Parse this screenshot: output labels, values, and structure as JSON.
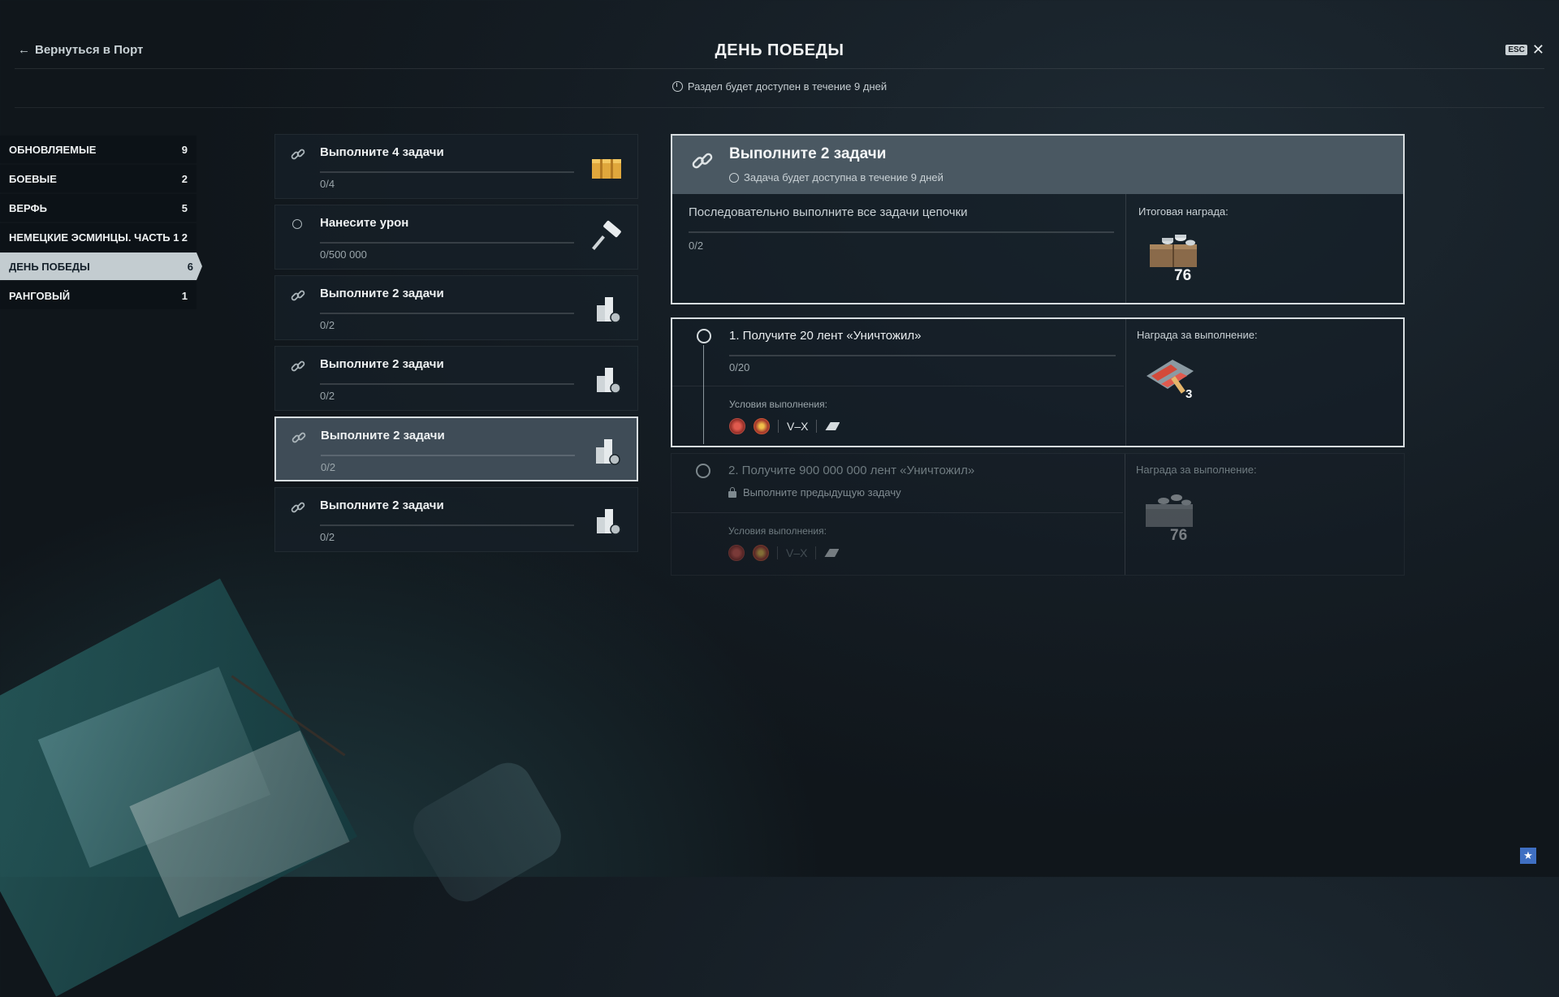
{
  "header": {
    "back_label": "Вернуться в Порт",
    "title": "ДЕНЬ ПОБЕДЫ",
    "esc_label": "ESC",
    "availability": "Раздел будет доступен в течение 9 дней"
  },
  "nav": {
    "items": [
      {
        "label": "ОБНОВЛЯЕМЫЕ",
        "count": "9"
      },
      {
        "label": "БОЕВЫЕ",
        "count": "2"
      },
      {
        "label": "ВЕРФЬ",
        "count": "5"
      },
      {
        "label": "НЕМЕЦКИЕ ЭСМИНЦЫ. ЧАСТЬ 1",
        "count": "2"
      },
      {
        "label": "ДЕНЬ ПОБЕДЫ",
        "count": "6"
      },
      {
        "label": "РАНГОВЫЙ",
        "count": "1"
      }
    ],
    "active_index": 4
  },
  "tasks": [
    {
      "name": "Выполните 4 задачи",
      "progress": "0/4",
      "icon": "chain-link-icon",
      "reward_icon": "gold-crates-icon"
    },
    {
      "name": "Нанесите урон",
      "progress": "0/500 000",
      "icon": "circle-icon",
      "reward_icon": "camouflage-roller-icon"
    },
    {
      "name": "Выполните 2 задачи",
      "progress": "0/2",
      "icon": "chain-link-icon",
      "reward_icon": "credits-stack-icon"
    },
    {
      "name": "Выполните 2 задачи",
      "progress": "0/2",
      "icon": "chain-link-icon",
      "reward_icon": "credits-stack-icon"
    },
    {
      "name": "Выполните 2 задачи",
      "progress": "0/2",
      "icon": "chain-link-icon",
      "reward_icon": "credits-stack-icon"
    },
    {
      "name": "Выполните 2 задачи",
      "progress": "0/2",
      "icon": "chain-link-icon",
      "reward_icon": "credits-stack-icon"
    }
  ],
  "detail": {
    "title": "Выполните 2 задачи",
    "subtitle": "Задача будет доступна в течение 9 дней",
    "description": "Последовательно выполните все задачи цепочки",
    "progress": "0/2",
    "reward_label": "Итоговая награда:",
    "reward_amount": "76"
  },
  "subtasks": [
    {
      "title": "1. Получите 20 лент «Уничтожил»",
      "progress": "0/20",
      "conditions_label": "Условия выполнения:",
      "tiers": "V–X",
      "reward_label": "Награда за выполнение:",
      "reward_amount": "3"
    },
    {
      "title": "2. Получите 900 000 000 лент «Уничтожил»",
      "locked_text": "Выполните предыдущую задачу",
      "conditions_label": "Условия выполнения:",
      "tiers": "V–X",
      "reward_label": "Награда за выполнение:",
      "reward_amount": "76"
    }
  ],
  "colors": {
    "active_border": "#d7dde0",
    "active_nav_bg": "#c3ccd0",
    "detail_header_bg": "#4a5862"
  }
}
